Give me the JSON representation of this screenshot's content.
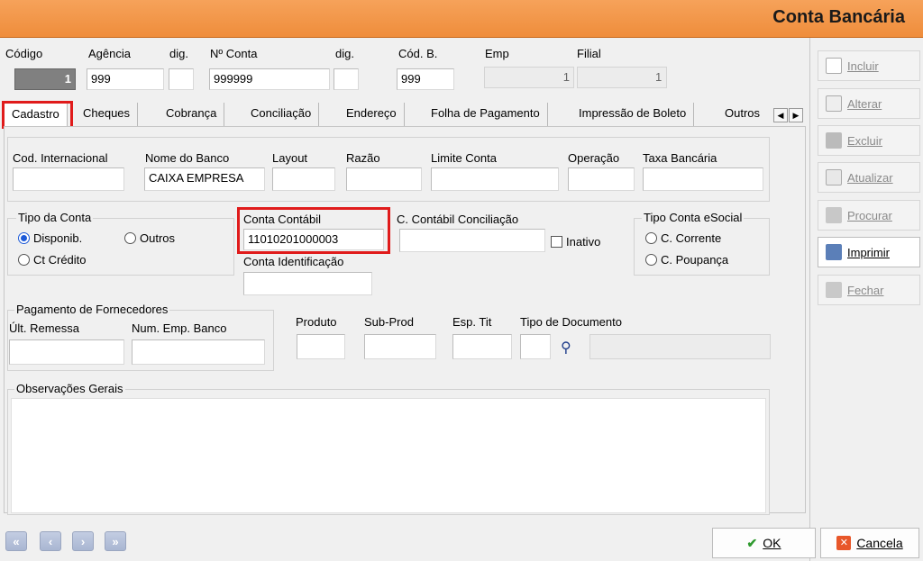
{
  "window": {
    "title": "Conta Bancária"
  },
  "top_fields": {
    "codigo_label": "Código",
    "codigo_value": "1",
    "agencia_label": "Agência",
    "agencia_value": "999",
    "dig1_label": "dig.",
    "dig1_value": "",
    "nconta_label": "Nº Conta",
    "nconta_value": "999999",
    "dig2_label": "dig.",
    "dig2_value": "",
    "codb_label": "Cód. B.",
    "codb_value": "999",
    "emp_label": "Emp",
    "emp_value": "1",
    "filial_label": "Filial",
    "filial_value": "1"
  },
  "tabs": [
    "Cadastro",
    "Cheques",
    "Cobrança",
    "Conciliação",
    "Endereço",
    "Folha de Pagamento",
    "Impressão de Boleto",
    "Outros"
  ],
  "cadastro": {
    "cod_internacional_label": "Cod. Internacional",
    "cod_internacional_value": "",
    "nome_banco_label": "Nome do Banco",
    "nome_banco_value": "CAIXA EMPRESA",
    "layout_label": "Layout",
    "layout_value": "",
    "razao_label": "Razão",
    "razao_value": "",
    "limite_label": "Limite Conta",
    "limite_value": "",
    "operacao_label": "Operação",
    "operacao_value": "",
    "taxa_label": "Taxa Bancária",
    "taxa_value": "",
    "tipo_conta_label": "Tipo da Conta",
    "tipo_conta_options": [
      "Disponib.",
      "Outros",
      "Ct Crédito"
    ],
    "tipo_conta_selected": "Disponib.",
    "conta_contabil_label": "Conta Contábil",
    "conta_contabil_value": "11010201000003",
    "conta_identificacao_label": "Conta Identificação",
    "conta_identificacao_value": "",
    "cc_conciliacao_label": "C. Contábil Conciliação",
    "cc_conciliacao_value": "",
    "inativo_label": "Inativo",
    "inativo_checked": false,
    "esocial_label": "Tipo Conta eSocial",
    "esocial_options": [
      "C. Corrente",
      "C. Poupança"
    ],
    "pag_forn_label": "Pagamento de Fornecedores",
    "ult_remessa_label": "Últ. Remessa",
    "ult_remessa_value": "",
    "num_emp_label": "Num. Emp. Banco",
    "num_emp_value": "",
    "produto_label": "Produto",
    "produto_value": "",
    "subprod_label": "Sub-Prod",
    "subprod_value": "",
    "esp_tit_label": "Esp. Tit",
    "esp_tit_value": "",
    "tipo_doc_label": "Tipo de Documento",
    "tipo_doc_value": "",
    "tipo_doc_desc": "",
    "obs_label": "Observações Gerais",
    "obs_value": ""
  },
  "sidebar": {
    "incluir": "Incluir",
    "alterar": "Alterar",
    "excluir": "Excluir",
    "atualizar": "Atualizar",
    "procurar": "Procurar",
    "imprimir": "Imprimir",
    "fechar": "Fechar"
  },
  "footer": {
    "ok": "OK",
    "cancela": "Cancela"
  },
  "colors": {
    "header": "#ef8d3b",
    "highlight": "#e01b1b",
    "radio_selected": "#1e5bd8"
  }
}
